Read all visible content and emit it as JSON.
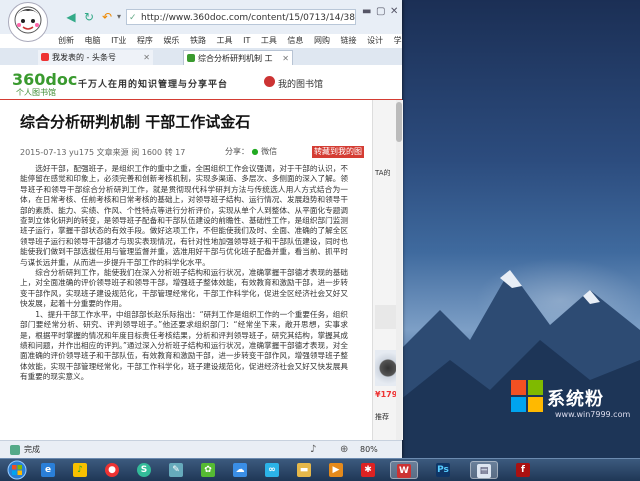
{
  "browser": {
    "address": "http://www.360doc.com/content/15/0713/14/38731",
    "bookmarks": [
      "创新",
      "电脑",
      "IT业",
      "程序",
      "娱乐",
      "铁路",
      "工具",
      "IT",
      "工具",
      "信息",
      "网购",
      "链接",
      "设计",
      "学"
    ],
    "tabs": [
      {
        "label": "我发表的 - 头条号",
        "active": false
      },
      {
        "label": "综合分析研判机制 工",
        "active": true
      }
    ],
    "status_text": "完成",
    "zoom": "80%"
  },
  "site": {
    "logo": "360doc",
    "logo_sub": "个人图书馆",
    "slogan": "千万人在用的知识管理与分享平台",
    "my_library": "我的图书馆"
  },
  "article": {
    "title": "综合分析研判机制  干部工作试金石",
    "meta": "2015-07-13  yu175  文章来源  阅 1600  转 17",
    "share_label": "分享：",
    "share_wechat": "微信",
    "favorite_button": "转藏到我的图书馆",
    "paragraphs": [
      "选好干部，配强班子，是组织工作的重中之重，全国组织工作会议强调，对于干部的认识，不能停留在感觉和印象上，必须完善和创新考核机制，实现多渠道、多层次、多侧面的深入了解。领导班子和领导干部综合分析研判工作，就是贯彻现代科学研判方法与传统选人用人方式结合为一体，在日常考核、任前考核和日常考核的基础上，对领导班子结构、运行情况、发展趋势和领导干部的素质、能力、实绩、作风、个性特点等进行分析评价，实现从单个人到整体、从平面化专题调查到立体化研判的转变，是领导班子配备和干部队伍建设的前瞻性、基础性工作，是组织部门监测班子运行，掌握干部状态的有效手段。做好这项工作，不但能使我们及时、全面、准确的了解全区领导班子运行和领导干部德才与现实表现情况，有针对性地加强领导班子和干部队伍建设，同时也能使我们做到干部选拔任用与管理监督并重，选准用好干部与优化班子配备并重，看当前、抓平时与谋长远并重，从而进一步提升干部工作的科学化水平。",
      "综合分析研判工作，能使我们在深入分析班子结构和运行状况，准确掌握干部德才表现的基础上，对全面准确的评价领导班子和领导干部，增强班子整体效能，有效教育和激励干部，进一步转变干部作风，实现班子建设规范化，干部管理经常化，干部工作科学化，促进全区经济社会又好又快发展，起着十分重要的作用。",
      "1、提升干部工作水平，中组部部长赵乐际指出：“研判工作是组织工作的一个重要任务，组织部门要经常分析、研究、评判领导班子。”他还要求组织部门：“经常坐下来，敞开思想，实事求是，根据平时掌握的情况和年度目标责任考核结果，分析和评判领导班子，研究其结构，掌握其成绩和问题，并作出相应的评判。”通过深入分析班子结构和运行状况，准确掌握干部德才表现，对全面准确的评价领导班子和干部队伍，有效教育和激励干部，进一步转变干部作风，增强领导班子整体效能，实现干部管理经常化，干部工作科学化，班子建设规范化，促进经济社会又好又快发展具有重要的现实意义。"
    ]
  },
  "sidebar": {
    "label1": "TA的",
    "price": "¥179",
    "label2": "推荐"
  },
  "desktop": {
    "brand": "系统粉",
    "brand_url": "www.win7999.com"
  },
  "taskbar": {
    "icons": [
      "ie-icon",
      "qq-music-icon",
      "chrome-icon",
      "browser-360-icon",
      "baidu-netdisk-icon",
      "folder-icon",
      "wps-icon",
      "photoshop-icon",
      "sougou-icon",
      "flash-icon"
    ]
  },
  "colors": {
    "accent_red": "#d43c33",
    "logo_green": "#3a9a2f"
  }
}
